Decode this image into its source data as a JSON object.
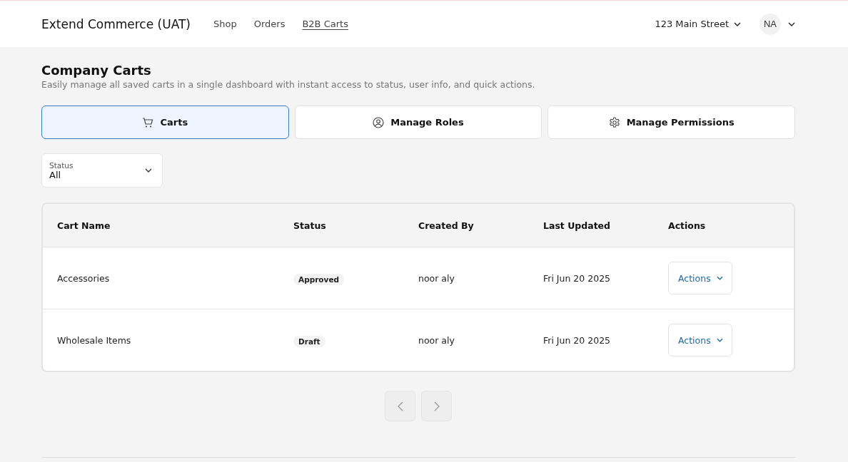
{
  "header": {
    "brand": "Extend Commerce (UAT)",
    "nav": [
      {
        "label": "Shop",
        "selected": false
      },
      {
        "label": "Orders",
        "selected": false
      },
      {
        "label": "B2B Carts",
        "selected": true
      }
    ],
    "address": "123 Main Street",
    "avatar": "NA"
  },
  "page": {
    "title": "Company Carts",
    "subtitle": "Easily manage all saved carts in a single dashboard with instant access to status, user info, and quick actions."
  },
  "tabs": [
    {
      "label": "Carts",
      "selected": true
    },
    {
      "label": "Manage Roles",
      "selected": false
    },
    {
      "label": "Manage Permissions",
      "selected": false
    }
  ],
  "filter": {
    "label": "Status",
    "value": "All"
  },
  "table": {
    "columns": [
      "Cart Name",
      "Status",
      "Created By",
      "Last Updated",
      "Actions"
    ],
    "rows": [
      {
        "name": "Accessories",
        "status": "Approved",
        "created_by": "noor aly",
        "updated": "Fri Jun 20 2025",
        "action": "Actions"
      },
      {
        "name": "Wholesale Items",
        "status": "Draft",
        "created_by": "noor aly",
        "updated": "Fri Jun 20 2025",
        "action": "Actions"
      }
    ]
  },
  "pagination": {
    "prev_disabled": true,
    "next_disabled": true
  }
}
